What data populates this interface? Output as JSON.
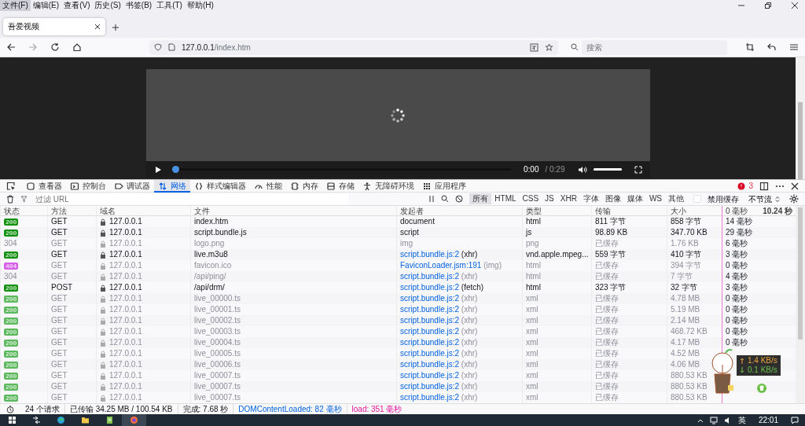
{
  "menu_bar": [
    {
      "label": "文件(F)",
      "selected": true
    },
    {
      "label": "编辑(E)",
      "selected": false
    },
    {
      "label": "查看(V)",
      "selected": false
    },
    {
      "label": "历史(S)",
      "selected": false
    },
    {
      "label": "书签(B)",
      "selected": false
    },
    {
      "label": "工具(T)",
      "selected": false
    },
    {
      "label": "帮助(H)",
      "selected": false
    }
  ],
  "tabs": [
    {
      "title": "吾爱视频",
      "selected": true
    }
  ],
  "address_bar": {
    "host": "127.0.0.1",
    "path": "/index.htm"
  },
  "search_bar": {
    "placeholder": "搜索"
  },
  "video_player": {
    "loading": true,
    "progress": {
      "level": 0
    },
    "current_time": "0:00",
    "duration": "/ 0:29",
    "volume": {
      "level": 1
    }
  },
  "devtools": {
    "tabs": [
      {
        "label": "查看器",
        "selected": false
      },
      {
        "label": "控制台",
        "selected": false
      },
      {
        "label": "调试器",
        "selected": false
      },
      {
        "label": "网络",
        "selected": true
      },
      {
        "label": "样式编辑器",
        "selected": false
      },
      {
        "label": "性能",
        "selected": false
      },
      {
        "label": "内存",
        "selected": false
      },
      {
        "label": "存储",
        "selected": false
      },
      {
        "label": "无障碍环境",
        "selected": false
      },
      {
        "label": "应用程序",
        "selected": false
      }
    ],
    "error_count": "3",
    "filter": {
      "placeholder": "过滤 URL"
    },
    "type_filters": [
      {
        "label": "所有",
        "selected": true
      },
      {
        "label": "HTML",
        "selected": false
      },
      {
        "label": "CSS",
        "selected": false
      },
      {
        "label": "JS",
        "selected": false
      },
      {
        "label": "XHR",
        "selected": false
      },
      {
        "label": "字体",
        "selected": false
      },
      {
        "label": "图像",
        "selected": false
      },
      {
        "label": "媒体",
        "selected": false
      },
      {
        "label": "WS",
        "selected": false
      },
      {
        "label": "其他",
        "selected": false
      }
    ],
    "disable_cache": {
      "label": "禁用缓存",
      "checked": false
    },
    "throttling": "不节流"
  },
  "table": {
    "columns": [
      "状态",
      "方法",
      "域名",
      "文件",
      "发起者",
      "类型",
      "传输",
      "大小"
    ],
    "waterfall_start": "0 毫秒",
    "waterfall_end": "10.24 秒",
    "rows": [
      {
        "status": "200",
        "color": "#12900f",
        "method": "GET",
        "domain": "127.0.0.1",
        "file": "index.htm",
        "initiator": "document",
        "type": "html",
        "transferred": "811 字节",
        "size": "858 字节",
        "timing": "14 毫秒",
        "dimmed": false
      },
      {
        "status": "200",
        "color": "#12900f",
        "method": "GET",
        "domain": "127.0.0.1",
        "file": "script.bundle.js",
        "initiator": "script",
        "type": "js",
        "transferred": "98.89 KB",
        "size": "347.70 KB",
        "timing": "29 毫秒",
        "dimmed": false
      },
      {
        "status": "304",
        "method": "GET",
        "domain": "127.0.0.1",
        "file": "logo.png",
        "initiator": "img",
        "type": "png",
        "transferred": "已缓存",
        "size": "1.76 KB",
        "timing": "6 毫秒",
        "dimmed": true
      },
      {
        "status": "200",
        "color": "#12900f",
        "method": "GET",
        "domain": "127.0.0.1",
        "file": "live.m3u8",
        "initiator_link": "script.bundle.js:2",
        "initiator_cause": "(xhr)",
        "type": "vnd.apple.mpeg...",
        "transferred": "559 字节",
        "size": "410 字节",
        "timing": "3 毫秒",
        "dimmed": false
      },
      {
        "status": "404",
        "color": "#d660e8",
        "method": "GET",
        "domain": "127.0.0.1",
        "file": "favicon.ico",
        "initiator_link": "FaviconLoader.jsm:191",
        "initiator_cause": "(img)",
        "type": "html",
        "transferred": "已缓存",
        "size": "394 字节",
        "timing": "0 毫秒",
        "dimmed": true
      },
      {
        "status": "304",
        "method": "GET",
        "domain": "127.0.0.1",
        "file": "/api/ping/",
        "initiator_link": "script.bundle.js:2",
        "initiator_cause": "(xhr)",
        "type": "html",
        "transferred": "已缓存",
        "size": "7 字节",
        "timing": "4 毫秒",
        "dimmed": true
      },
      {
        "status": "200",
        "color": "#12900f",
        "method": "POST",
        "domain": "127.0.0.1",
        "file": "/api/drm/",
        "initiator_link": "script.bundle.js:2",
        "initiator_cause": "(fetch)",
        "type": "html",
        "transferred": "323 字节",
        "size": "32 字节",
        "timing": "3 毫秒",
        "dimmed": false
      },
      {
        "status": "200",
        "color": "#5cb85c",
        "method": "GET",
        "domain": "127.0.0.1",
        "file": "live_00000.ts",
        "initiator_link": "script.bundle.js:2",
        "initiator_cause": "(xhr)",
        "type": "xml",
        "transferred": "已缓存",
        "size": "4.78 MB",
        "timing": "0 毫秒",
        "dimmed": true
      },
      {
        "status": "200",
        "color": "#5cb85c",
        "method": "GET",
        "domain": "127.0.0.1",
        "file": "live_00001.ts",
        "initiator_link": "script.bundle.js:2",
        "initiator_cause": "(xhr)",
        "type": "xml",
        "transferred": "已缓存",
        "size": "5.19 MB",
        "timing": "0 毫秒",
        "dimmed": true
      },
      {
        "status": "200",
        "color": "#5cb85c",
        "method": "GET",
        "domain": "127.0.0.1",
        "file": "live_00002.ts",
        "initiator_link": "script.bundle.js:2",
        "initiator_cause": "(xhr)",
        "type": "xml",
        "transferred": "已缓存",
        "size": "2.14 MB",
        "timing": "0 毫秒",
        "dimmed": true
      },
      {
        "status": "200",
        "color": "#5cb85c",
        "method": "GET",
        "domain": "127.0.0.1",
        "file": "live_00003.ts",
        "initiator_link": "script.bundle.js:2",
        "initiator_cause": "(xhr)",
        "type": "xml",
        "transferred": "已缓存",
        "size": "468.72 KB",
        "timing": "0 毫秒",
        "dimmed": true
      },
      {
        "status": "200",
        "color": "#5cb85c",
        "method": "GET",
        "domain": "127.0.0.1",
        "file": "live_00004.ts",
        "initiator_link": "script.bundle.js:2",
        "initiator_cause": "(xhr)",
        "type": "xml",
        "transferred": "已缓存",
        "size": "4.17 MB",
        "timing": "0 毫秒",
        "dimmed": true
      },
      {
        "status": "200",
        "color": "#5cb85c",
        "method": "GET",
        "domain": "127.0.0.1",
        "file": "live_00005.ts",
        "initiator_link": "script.bundle.js:2",
        "initiator_cause": "(xhr)",
        "type": "xml",
        "transferred": "已缓存",
        "size": "4.52 MB",
        "dimmed": true
      },
      {
        "status": "200",
        "color": "#5cb85c",
        "method": "GET",
        "domain": "127.0.0.1",
        "file": "live_00006.ts",
        "initiator_link": "script.bundle.js:2",
        "initiator_cause": "(xhr)",
        "type": "xml",
        "transferred": "已缓存",
        "size": "4.06 MB",
        "dimmed": true
      },
      {
        "status": "200",
        "color": "#5cb85c",
        "method": "GET",
        "domain": "127.0.0.1",
        "file": "live_00007.ts",
        "initiator_link": "script.bundle.js:2",
        "initiator_cause": "(xhr)",
        "type": "xml",
        "transferred": "已缓存",
        "size": "880.53 KB",
        "dimmed": true
      },
      {
        "status": "200",
        "color": "#5cb85c",
        "method": "GET",
        "domain": "127.0.0.1",
        "file": "live_00007.ts",
        "initiator_link": "script.bundle.js:2",
        "initiator_cause": "(xhr)",
        "type": "xml",
        "transferred": "已缓存",
        "size": "880.53 KB",
        "dimmed": true
      },
      {
        "status": "200",
        "color": "#5cb85c",
        "method": "GET",
        "domain": "127.0.0.1",
        "file": "live_00007.ts",
        "initiator_link": "script.bundle.js:2",
        "initiator_cause": "(xhr)",
        "type": "xml",
        "transferred": "已缓存",
        "size": "880.53 KB",
        "dimmed": true
      }
    ]
  },
  "status_bar": {
    "requests": "24 个请求",
    "transferred": "已传输 34.25 MB / 100.54 KB",
    "finish": "完成: 7.68 秒",
    "dom_content_loaded": "DOMContentLoaded: 82 毫秒",
    "load": "load: 351 毫秒"
  },
  "speed_overlay": {
    "upload": "1.4 KB/s",
    "download": "0.1 KB/s"
  },
  "taskbar": {
    "input_method": "英",
    "clock": "22:01"
  }
}
